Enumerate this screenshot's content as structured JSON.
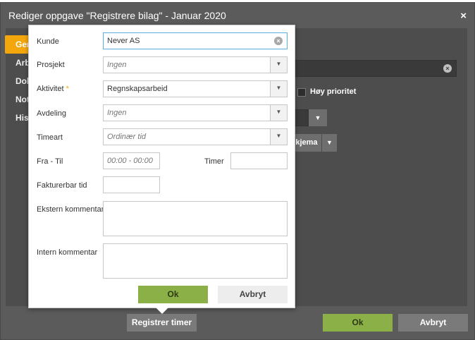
{
  "dialog": {
    "title": "Rediger oppgave \"Registrere bilag\" - Januar 2020",
    "close_glyph": "×",
    "tabs": [
      {
        "label": "Generelt",
        "active": true
      },
      {
        "label": "Arbeid",
        "active": false
      },
      {
        "label": "Dokumenter",
        "active": false
      },
      {
        "label": "Notater",
        "active": false
      },
      {
        "label": "Historikk",
        "active": false
      }
    ],
    "priority_label": "Høy prioritet",
    "template_button_label": "Skjema",
    "register_button_label": "Registrer timer",
    "ok_label": "Ok",
    "cancel_label": "Avbryt"
  },
  "form": {
    "kunde": {
      "label": "Kunde",
      "value": "Never AS"
    },
    "prosjekt": {
      "label": "Prosjekt",
      "placeholder": "Ingen"
    },
    "aktivitet": {
      "label": "Aktivitet",
      "required_mark": "*",
      "value": "Regnskapsarbeid"
    },
    "avdeling": {
      "label": "Avdeling",
      "placeholder": "Ingen"
    },
    "timeart": {
      "label": "Timeart",
      "placeholder": "Ordinær tid"
    },
    "fra_til": {
      "label": "Fra - Til",
      "placeholder": "00:00 - 00:00"
    },
    "timer": {
      "label": "Timer",
      "value": ""
    },
    "fakturerbar": {
      "label": "Fakturerbar tid",
      "value": ""
    },
    "ekstern": {
      "label": "Ekstern kommentar",
      "value": ""
    },
    "intern": {
      "label": "Intern kommentar",
      "value": ""
    },
    "ok_label": "Ok",
    "cancel_label": "Avbryt"
  },
  "icons": {
    "dropdown": "caret-down-icon",
    "clear": "clear-icon",
    "close": "close-icon"
  },
  "colors": {
    "accent": "#f4a70c",
    "ok": "#8cb048",
    "focus": "#5aaee0",
    "dialog_bg": "#5b5b5b"
  }
}
